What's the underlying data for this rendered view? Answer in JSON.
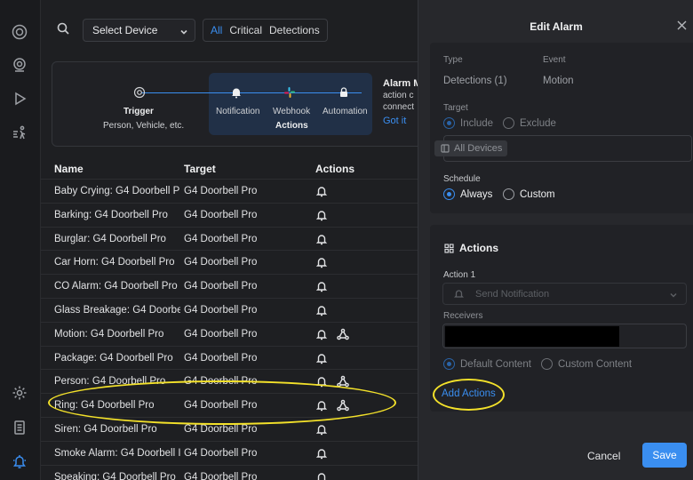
{
  "topbar": {
    "device_select": "Select Device",
    "filters": [
      "All",
      "Critical",
      "Detections"
    ]
  },
  "banner": {
    "trigger_title": "Trigger",
    "trigger_sub": "Person, Vehicle, etc.",
    "notification": "Notification",
    "webhook": "Webhook",
    "automation": "Automation",
    "actions": "Actions",
    "promo_title": "Alarm M",
    "promo_line1": "action c",
    "promo_line2": "connect",
    "promo_link": "Got it"
  },
  "table": {
    "headers": [
      "Name",
      "Target",
      "Actions"
    ],
    "rows": [
      {
        "name": "Baby Crying: G4 Doorbell P",
        "target": "G4 Doorbell Pro",
        "webhook": false
      },
      {
        "name": "Barking: G4 Doorbell Pro",
        "target": "G4 Doorbell Pro",
        "webhook": false
      },
      {
        "name": "Burglar: G4 Doorbell Pro",
        "target": "G4 Doorbell Pro",
        "webhook": false
      },
      {
        "name": "Car Horn: G4 Doorbell Pro",
        "target": "G4 Doorbell Pro",
        "webhook": false
      },
      {
        "name": "CO Alarm: G4 Doorbell Pro",
        "target": "G4 Doorbell Pro",
        "webhook": false
      },
      {
        "name": "Glass Breakage: G4 Doorbe",
        "target": "G4 Doorbell Pro",
        "webhook": false
      },
      {
        "name": "Motion: G4 Doorbell Pro",
        "target": "G4 Doorbell Pro",
        "webhook": true
      },
      {
        "name": "Package: G4 Doorbell Pro",
        "target": "G4 Doorbell Pro",
        "webhook": false
      },
      {
        "name": "Person: G4 Doorbell Pro",
        "target": "G4 Doorbell Pro",
        "webhook": true
      },
      {
        "name": "Ring: G4 Doorbell Pro",
        "target": "G4 Doorbell Pro",
        "webhook": true
      },
      {
        "name": "Siren: G4 Doorbell Pro",
        "target": "G4 Doorbell Pro",
        "webhook": false
      },
      {
        "name": "Smoke Alarm: G4 Doorbell I",
        "target": "G4 Doorbell Pro",
        "webhook": false
      },
      {
        "name": "Speaking: G4 Doorbell Pro",
        "target": "G4 Doorbell Pro",
        "webhook": false
      }
    ]
  },
  "panel": {
    "title": "Edit Alarm",
    "type_label": "Type",
    "event_label": "Event",
    "type_value": "Detections (1)",
    "event_value": "Motion",
    "target_label": "Target",
    "include": "Include",
    "exclude": "Exclude",
    "all_devices": "All Devices",
    "schedule_label": "Schedule",
    "always": "Always",
    "custom": "Custom",
    "actions_title": "Actions",
    "action1_label": "Action 1",
    "action1_value": "Send Notification",
    "receivers_label": "Receivers",
    "default_content": "Default Content",
    "custom_content": "Custom Content",
    "add_actions": "Add Actions",
    "cancel": "Cancel",
    "save": "Save"
  },
  "colors": {
    "accent": "#3a8ef0",
    "highlight": "#f3e12a",
    "background": "#1e1f22",
    "panel": "#27282c"
  }
}
